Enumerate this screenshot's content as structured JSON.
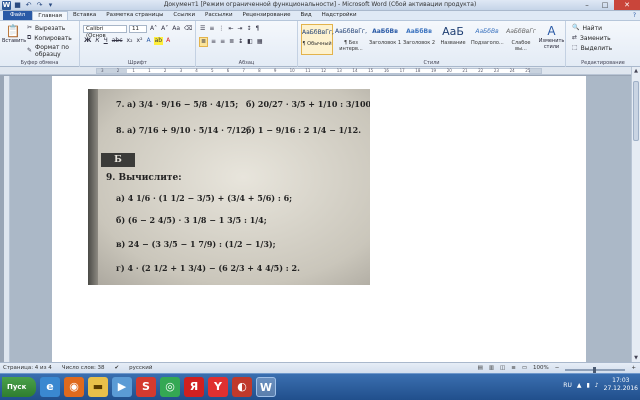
{
  "window": {
    "title": "Документ1 [Режим ограниченной функциональности] - Microsoft Word (Сбой активации продукта)"
  },
  "tabs": [
    {
      "label": "Файл"
    },
    {
      "label": "Главная"
    },
    {
      "label": "Вставка"
    },
    {
      "label": "Разметка страницы"
    },
    {
      "label": "Ссылки"
    },
    {
      "label": "Рассылки"
    },
    {
      "label": "Рецензирование"
    },
    {
      "label": "Вид"
    },
    {
      "label": "Надстройки"
    }
  ],
  "ribbon": {
    "clipboard": {
      "paste": "Вставить",
      "cut": "Вырезать",
      "copy": "Копировать",
      "format_painter": "Формат по образцу",
      "label": "Буфер обмена"
    },
    "font": {
      "family": "Calibri (Основ",
      "size": "11",
      "label": "Шрифт"
    },
    "paragraph": {
      "label": "Абзац"
    },
    "styles": {
      "label": "Стили",
      "items": [
        {
          "preview": "АаБбВвГг,",
          "name": "¶ Обычный"
        },
        {
          "preview": "АаБбВвГг,",
          "name": "¶ Без интерв..."
        },
        {
          "preview": "АаБбВв",
          "name": "Заголовок 1"
        },
        {
          "preview": "АаБбВв",
          "name": "Заголовок 2"
        },
        {
          "preview": "АаБ",
          "name": "Название"
        },
        {
          "preview": "АаБбВв",
          "name": "Подзаголо..."
        },
        {
          "preview": "АаБбВвГг",
          "name": "Слабое вы..."
        }
      ],
      "change": "Изменить стили"
    },
    "editing": {
      "find": "Найти",
      "replace": "Заменить",
      "select": "Выделить",
      "label": "Редактирование"
    }
  },
  "ruler": {
    "ticks": [
      "3",
      "2",
      "1",
      "1",
      "2",
      "3",
      "4",
      "5",
      "6",
      "7",
      "8",
      "9",
      "10",
      "11",
      "12",
      "13",
      "14",
      "15",
      "16",
      "17",
      "18",
      "19",
      "20",
      "21",
      "22",
      "23",
      "24",
      "25"
    ]
  },
  "math": {
    "l7a": "7. а) 3/4 · 9/16 − 5/8 · 4/15;",
    "l7b": "б) 20/27 · 3/5 + 1/10 : 3/100;",
    "l8a": "8. а) 7/16 + 9/10 · 5/14 · 7/12;",
    "l8b": "б) 1 − 9/16 : 2 1/4 − 1/12.",
    "badge": "Б",
    "l9": "9. Вычислите:",
    "l9a": "а) 4 1/6 · (1 1/2 − 3/5) + (3/4 + 5/6) : 6;",
    "l9b": "б) (6 − 2 4/5) · 3 1/8 − 1 3/5 : 1/4;",
    "l9c": "в) 24 − (3 3/5 − 1 7/9) : (1/2 − 1/3);",
    "l9d": "г) 4 · (2 1/2 + 1 3/4) − (6 2/3 + 4 4/5) : 2."
  },
  "status": {
    "page": "Страница: 4 из 4",
    "words": "Число слов: 38",
    "lang": "русский",
    "zoom": "100%"
  },
  "taskbar": {
    "start": "Пуск",
    "lang": "RU",
    "time": "17:03",
    "date": "27.12.2016"
  }
}
